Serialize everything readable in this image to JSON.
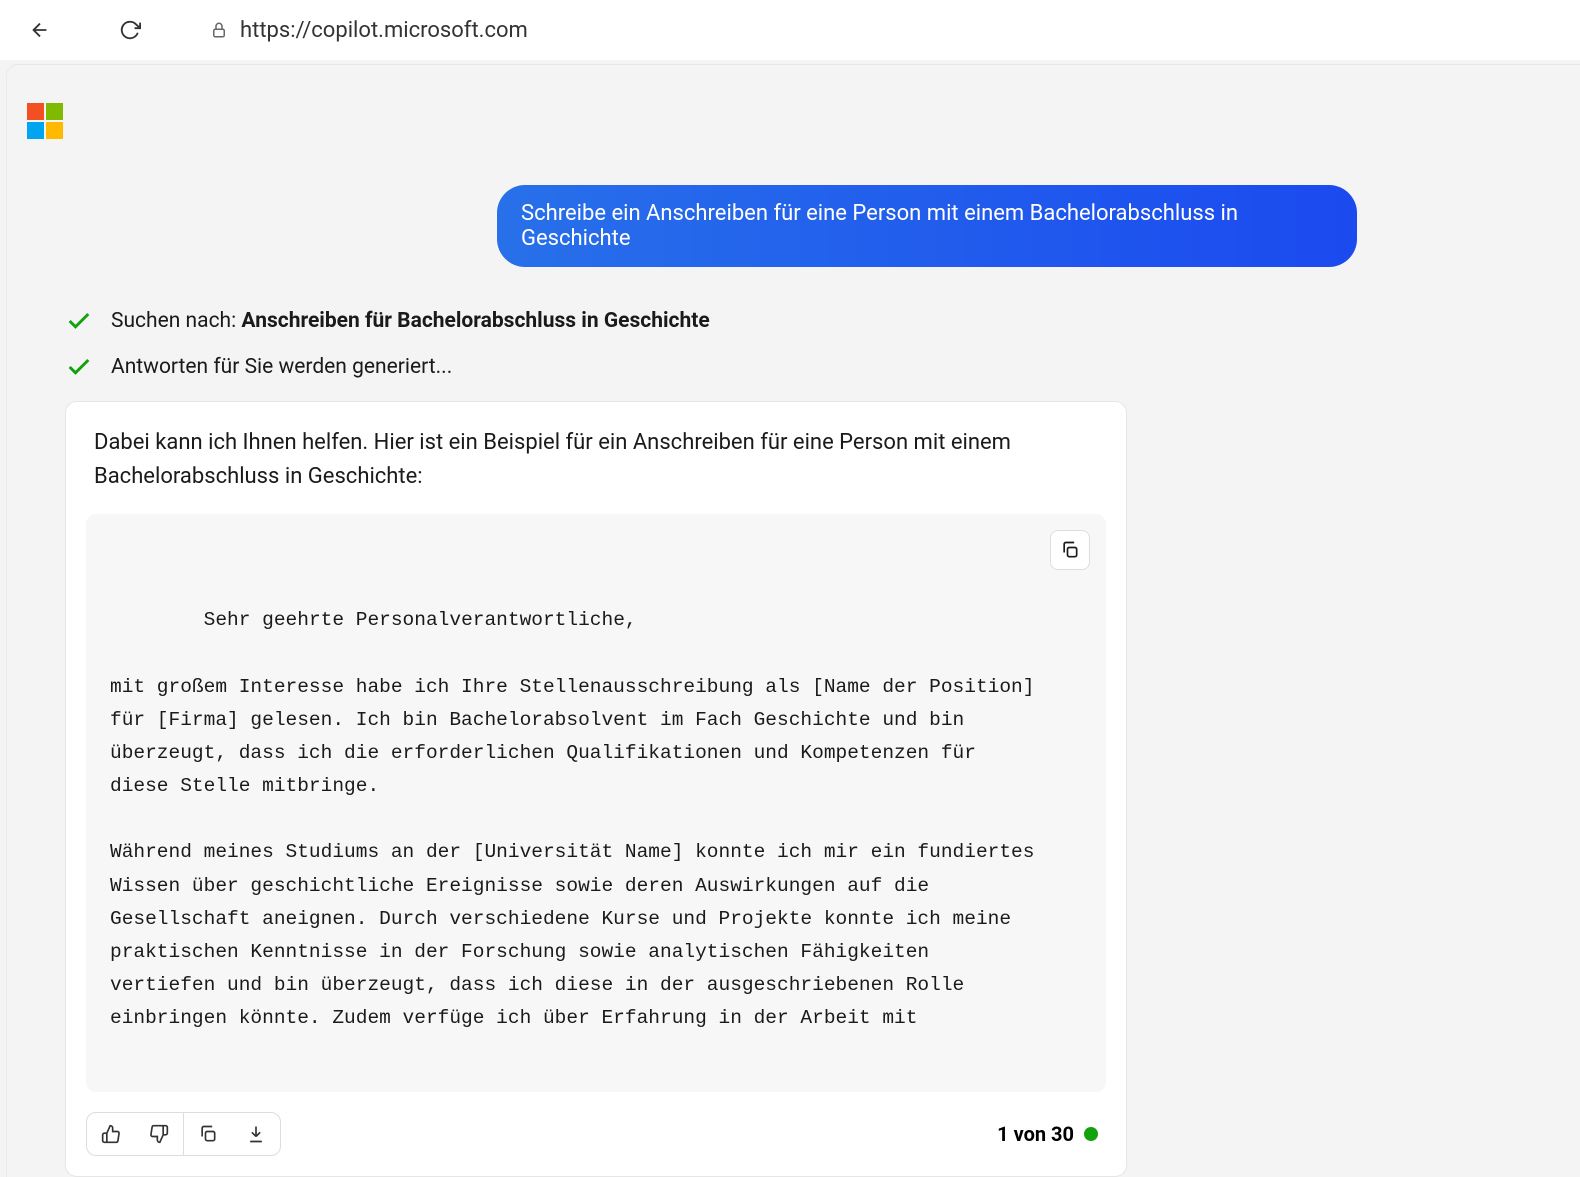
{
  "browser": {
    "url": "https://copilot.microsoft.com"
  },
  "chat": {
    "user_message": "Schreibe ein Anschreiben für eine Person mit einem Bachelorabschluss in Geschichte",
    "status1_prefix": "Suchen nach: ",
    "status1_bold": "Anschreiben für Bachelorabschluss in Geschichte",
    "status2": "Antworten für Sie werden generiert...",
    "intro": "Dabei kann ich Ihnen helfen. Hier ist ein Beispiel für ein Anschreiben für eine Person mit einem Bachelorabschluss in Geschichte:",
    "letter": "Sehr geehrte Personalverantwortliche,\n\nmit großem Interesse habe ich Ihre Stellenausschreibung als [Name der Position] für [Firma] gelesen. Ich bin Bachelorabsolvent im Fach Geschichte und bin überzeugt, dass ich die erforderlichen Qualifikationen und Kompetenzen für diese Stelle mitbringe.\n\nWährend meines Studiums an der [Universität Name] konnte ich mir ein fundiertes Wissen über geschichtliche Ereignisse sowie deren Auswirkungen auf die Gesellschaft aneignen. Durch verschiedene Kurse und Projekte konnte ich meine praktischen Kenntnisse in der Forschung sowie analytischen Fähigkeiten vertiefen und bin überzeugt, dass ich diese in der ausgeschriebenen Rolle einbringen könnte. Zudem verfüge ich über Erfahrung in der Arbeit mit",
    "counter": "1 von 30"
  }
}
